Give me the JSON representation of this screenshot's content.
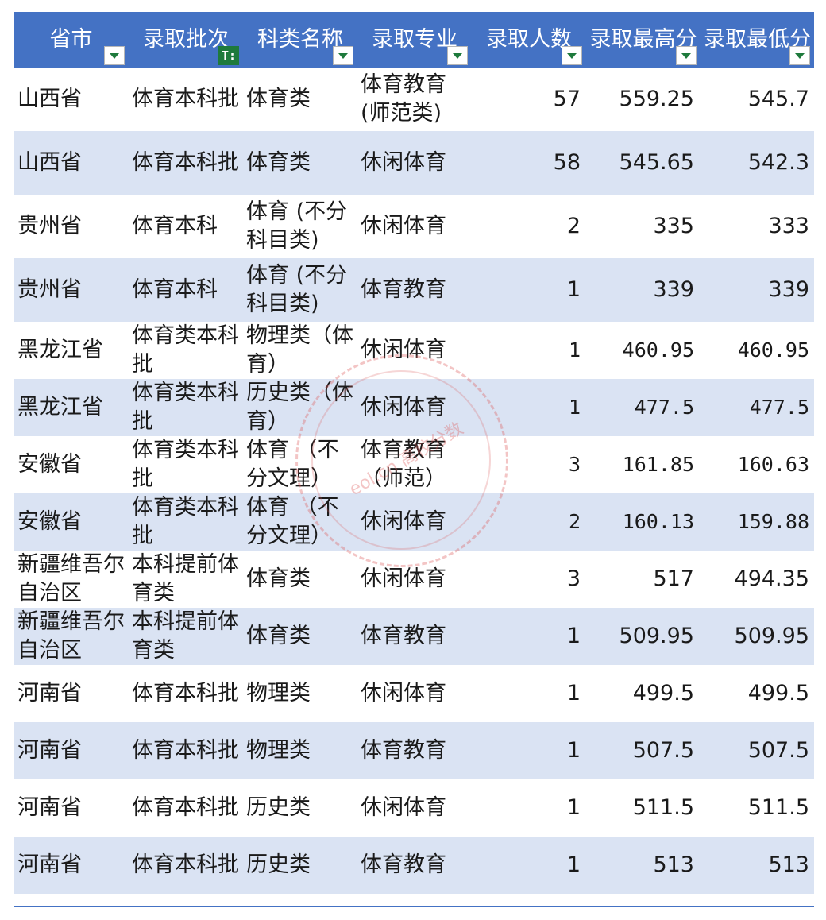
{
  "header": {
    "columns": [
      {
        "label": "省市"
      },
      {
        "label": "录取批次"
      },
      {
        "label": "科类名称"
      },
      {
        "label": "录取专业"
      },
      {
        "label": "录取人数"
      },
      {
        "label": "录取最高分"
      },
      {
        "label": "录取最低分"
      }
    ]
  },
  "rows": [
    {
      "province": "山西省",
      "batch": "体育本科批",
      "category": "体育类",
      "major": "体育教育(师范类)",
      "count": "57",
      "max": "559.25",
      "min": "545.7"
    },
    {
      "province": "山西省",
      "batch": "体育本科批",
      "category": "体育类",
      "major": "休闲体育",
      "count": "58",
      "max": "545.65",
      "min": "542.3"
    },
    {
      "province": "贵州省",
      "batch": "体育本科",
      "category": "体育 (不分科目类)",
      "major": "休闲体育",
      "count": "2",
      "max": "335",
      "min": "333"
    },
    {
      "province": "贵州省",
      "batch": "体育本科",
      "category": "体育 (不分科目类)",
      "major": "体育教育",
      "count": "1",
      "max": "339",
      "min": "339"
    },
    {
      "province": "黑龙江省",
      "batch": "体育类本科批",
      "category": "物理类（体育）",
      "major": "休闲体育",
      "count": "1",
      "max": "460.95",
      "min": "460.95"
    },
    {
      "province": "黑龙江省",
      "batch": "体育类本科批",
      "category": "历史类（体育）",
      "major": "休闲体育",
      "count": "1",
      "max": "477.5",
      "min": "477.5"
    },
    {
      "province": "安徽省",
      "batch": "体育类本科批",
      "category": "体育 （不分文理）",
      "major": "体育教育（师范）",
      "count": "3",
      "max": "161.85",
      "min": "160.63"
    },
    {
      "province": "安徽省",
      "batch": "体育类本科批",
      "category": "体育 （不分文理）",
      "major": "休闲体育",
      "count": "2",
      "max": "160.13",
      "min": "159.88"
    },
    {
      "province": "新疆维吾尔自治区",
      "batch": "本科提前体育类",
      "category": "体育类",
      "major": "休闲体育",
      "count": "3",
      "max": "517",
      "min": "494.35"
    },
    {
      "province": "新疆维吾尔自治区",
      "batch": "本科提前体育类",
      "category": "体育类",
      "major": "体育教育",
      "count": "1",
      "max": "509.95",
      "min": "509.95"
    },
    {
      "province": "河南省",
      "batch": "体育本科批",
      "category": "物理类",
      "major": "休闲体育",
      "count": "1",
      "max": "499.5",
      "min": "499.5"
    },
    {
      "province": "河南省",
      "batch": "体育本科批",
      "category": "物理类",
      "major": "体育教育",
      "count": "1",
      "max": "507.5",
      "min": "507.5"
    },
    {
      "province": "河南省",
      "batch": "体育本科批",
      "category": "历史类",
      "major": "休闲体育",
      "count": "1",
      "max": "511.5",
      "min": "511.5"
    },
    {
      "province": "河南省",
      "batch": "体育本科批",
      "category": "历史类",
      "major": "体育教育",
      "count": "1",
      "max": "513",
      "min": "513"
    }
  ],
  "watermark": {
    "text": "eol.cn 高校分数",
    "color": "#dc5a5a"
  },
  "colors": {
    "header_bg": "#4472c4",
    "alt_row": "#dae3f3",
    "filter_green": "#1e7a3c"
  }
}
